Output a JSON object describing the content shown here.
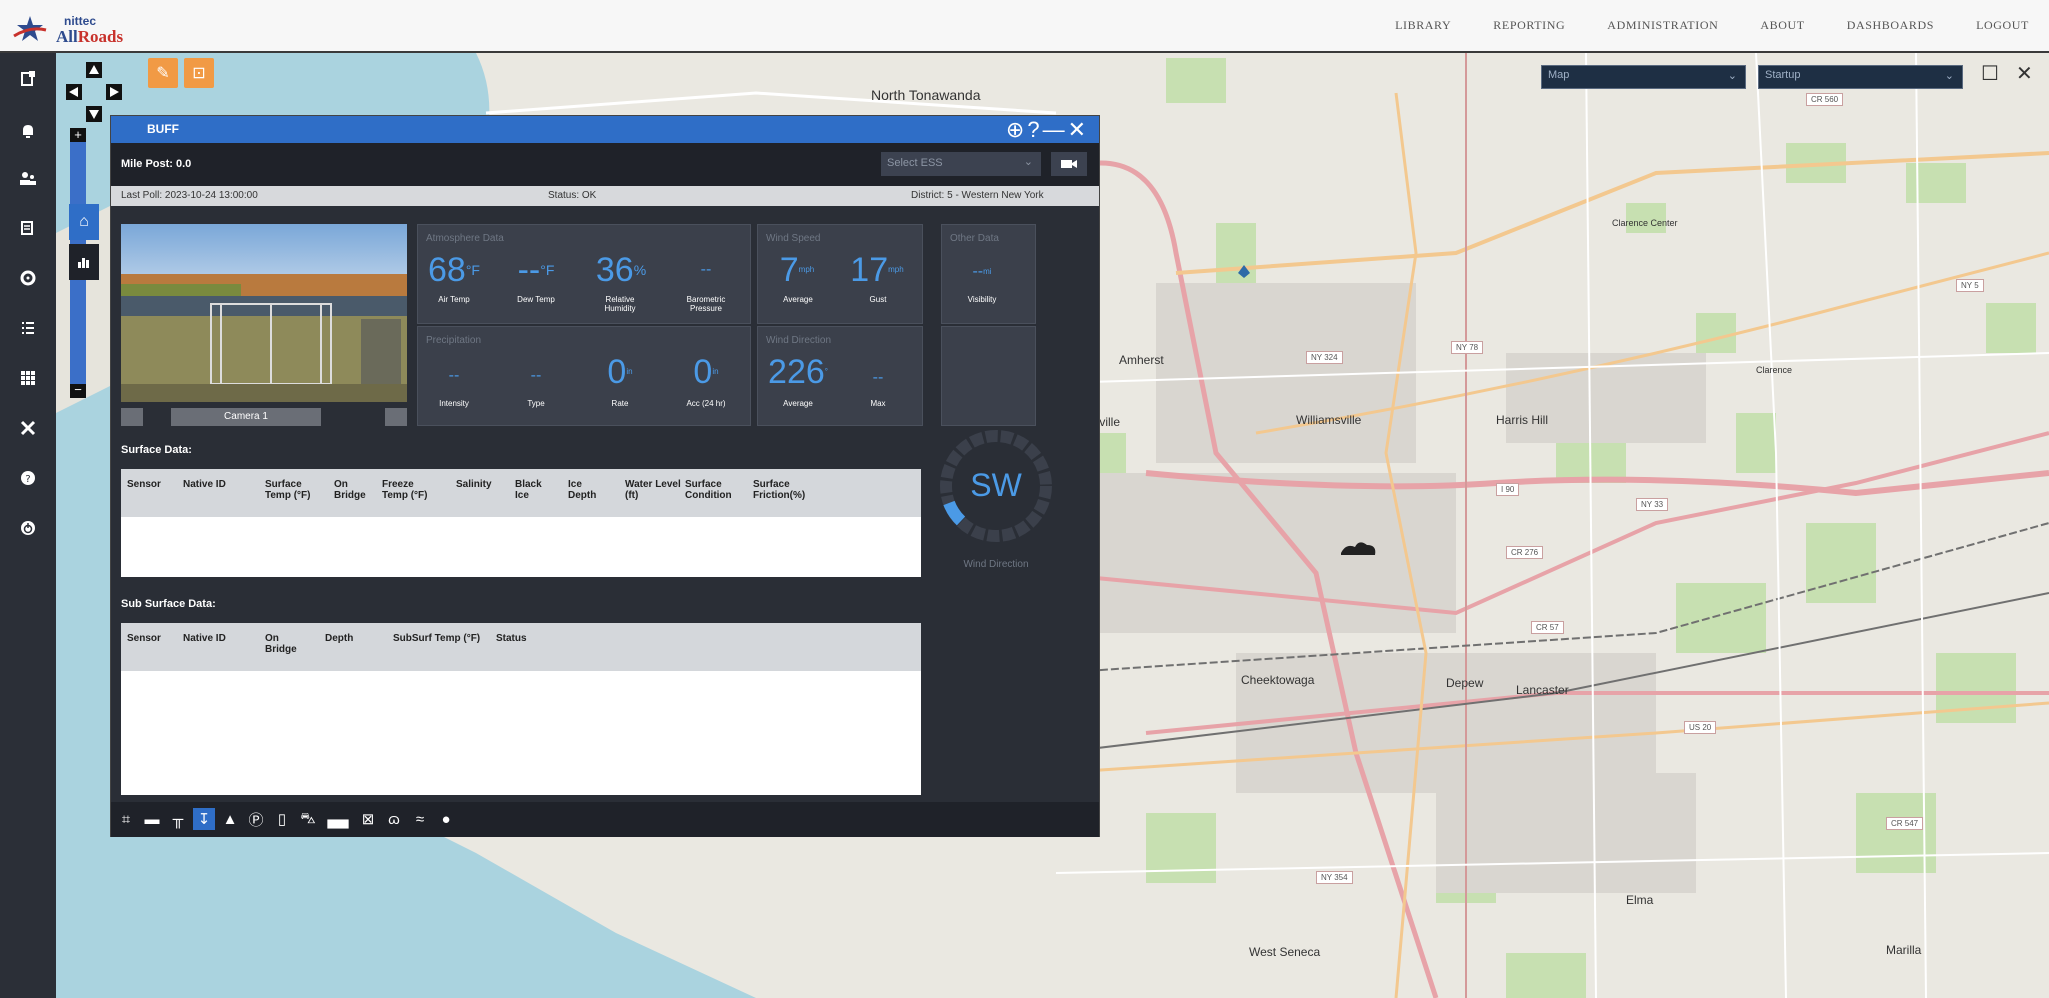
{
  "app": {
    "logo_top": "nittec",
    "logo_main_a": "All",
    "logo_main_b": "Roads"
  },
  "nav": {
    "items": [
      "LIBRARY",
      "REPORTING",
      "ADMINISTRATION",
      "ABOUT",
      "DASHBOARDS",
      "LOGOUT"
    ]
  },
  "sidebar": {
    "icons": [
      "clipboard-icon",
      "bell-icon",
      "users-icon",
      "report-icon",
      "target-icon",
      "list-icon",
      "grid-icon",
      "tools-icon",
      "help-icon",
      "power-icon"
    ]
  },
  "map": {
    "layer_select": "Map",
    "layout_select": "Startup",
    "labels": {
      "north_tonawanda": "North Tonawanda",
      "amherst": "Amherst",
      "williamsville": "Williamsville",
      "harris_hill": "Harris Hill",
      "cheektowaga": "Cheektowaga",
      "depew": "Depew",
      "lancaster": "Lancaster",
      "elma": "Elma",
      "west_seneca": "West Seneca",
      "marilla": "Marilla",
      "getzville": "Getzville",
      "clarence": "Clarence",
      "clarence_center": "Clarence Center"
    },
    "shields": {
      "cr560": "CR 560",
      "ny5": "NY 5",
      "ny78": "NY 78",
      "ny324": "NY 324",
      "i90": "I 90",
      "ny33": "NY 33",
      "cr276": "CR 276",
      "cr57": "CR 57",
      "us20": "US 20",
      "cr547": "CR 547",
      "ny354": "NY 354"
    }
  },
  "station": {
    "name": "BUFF",
    "mile_post": "Mile Post: 0.0",
    "select_ess_placeholder": "Select ESS",
    "last_poll": "Last Poll: 2023-10-24 13:00:00",
    "status": "Status: OK",
    "district": "District: 5 - Western New York",
    "camera_label": "Camera 1",
    "atmosphere": {
      "title": "Atmosphere Data",
      "air_temp": "68",
      "air_temp_unit": "°F",
      "air_temp_label": "Air Temp",
      "dew_temp": "--",
      "dew_temp_unit": "°F",
      "dew_temp_label": "Dew Temp",
      "humidity": "36",
      "humidity_unit": "%",
      "humidity_label": "Relative Humidity",
      "pressure": "--",
      "pressure_label": "Barometric Pressure"
    },
    "wind_speed": {
      "title": "Wind Speed",
      "average": "7",
      "average_unit": "mph",
      "average_label": "Average",
      "gust": "17",
      "gust_unit": "mph",
      "gust_label": "Gust"
    },
    "other": {
      "title": "Other Data",
      "visibility": "--",
      "visibility_unit": "mi",
      "visibility_label": "Visibility"
    },
    "precipitation": {
      "title": "Precipitation",
      "intensity": "--",
      "intensity_label": "Intensity",
      "type": "--",
      "type_label": "Type",
      "rate": "0",
      "rate_unit": "in",
      "rate_label": "Rate",
      "accum": "0",
      "accum_unit": "in",
      "accum_label": "Acc (24 hr)"
    },
    "wind_direction": {
      "title": "Wind Direction",
      "average": "226",
      "average_unit": "°",
      "average_label": "Average",
      "max": "--",
      "max_label": "Max"
    },
    "compass": {
      "direction": "SW",
      "label": "Wind Direction"
    },
    "surface": {
      "title": "Surface Data:",
      "columns": [
        "Sensor",
        "Native ID",
        "Surface Temp (°F)",
        "On Bridge",
        "Freeze Temp (°F)",
        "Salinity",
        "Black Ice",
        "Ice Depth",
        "Water Level (ft)",
        "Surface Condition",
        "Surface Friction(%)"
      ]
    },
    "subsurface": {
      "title": "Sub Surface Data:",
      "columns": [
        "Sensor",
        "Native ID",
        "On Bridge",
        "Depth",
        "SubSurf Temp (°F)",
        "Status"
      ]
    },
    "bottom_icons": [
      "junction-icon",
      "road-icon",
      "barrier-icon",
      "weather-station-icon",
      "warning-icon",
      "parking-icon",
      "signal-icon",
      "car-icon",
      "truck-icon",
      "sign-icon",
      "bike-icon",
      "wind-icon",
      "dot-icon"
    ]
  }
}
